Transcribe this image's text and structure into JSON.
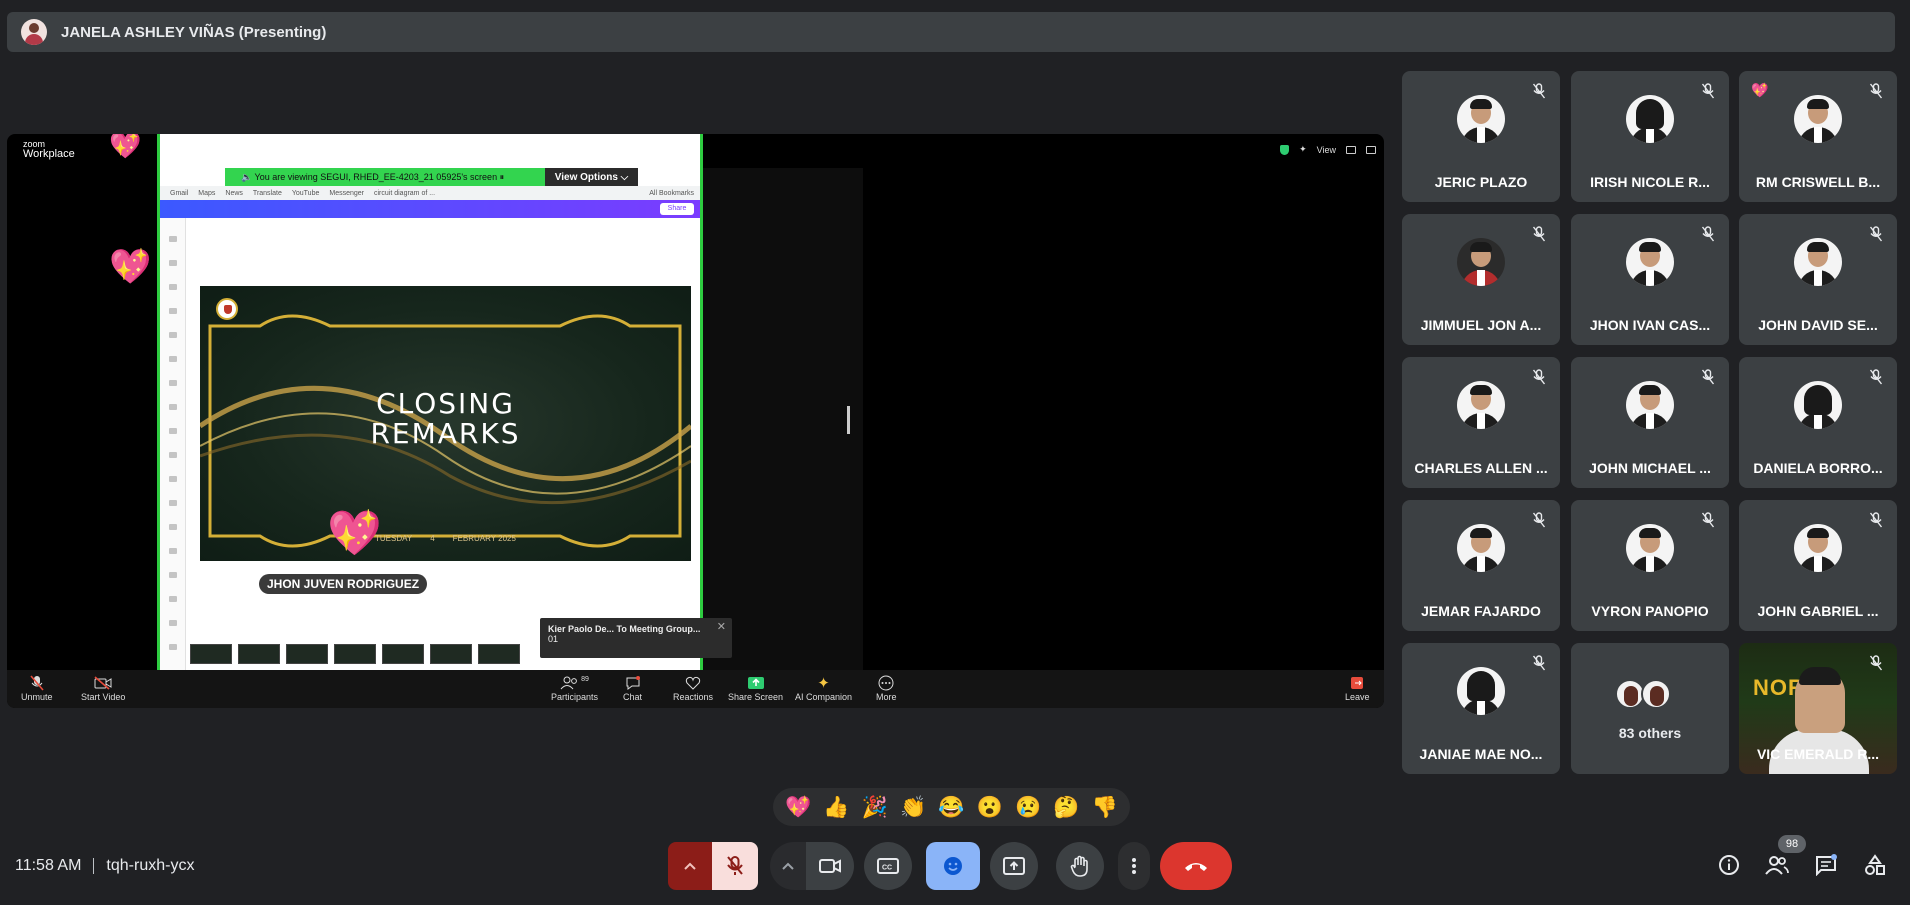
{
  "presenter": {
    "name": "JANELA ASHLEY VIÑAS (Presenting)"
  },
  "shared_screen": {
    "app_name_line1": "zoom",
    "app_name_line2": "Workplace",
    "view_label": "View",
    "banner_text": "🔈 You are viewing  SEGUI, RHED_EE-4203_21 05925's screen  ⏸",
    "view_options_label": "View Options ⌵",
    "browser_bookmarks": [
      "Gmail",
      "Maps",
      "News",
      "Translate",
      "YouTube",
      "Messenger",
      "circuit diagram of ...",
      "All Bookmarks"
    ],
    "share_label": "Share",
    "slide": {
      "title_line1": "CLOSING",
      "title_line2": "REMARKS",
      "date_day": "TUESDAY",
      "date_num": "4",
      "date_month": "FEBRUARY 2025"
    },
    "speaker_label": "JHON JUVEN RODRIGUEZ",
    "chat_toast": {
      "line1": "Kier Paolo De... To Meeting Group...",
      "line2": "01",
      "close": "✕"
    },
    "toolbar": {
      "unmute": "Unmute",
      "start_video": "Start Video",
      "participants": "Participants",
      "participants_count": "89",
      "chat": "Chat",
      "reactions": "Reactions",
      "share_screen": "Share Screen",
      "ai_companion": "AI Companion",
      "more": "More",
      "leave": "Leave"
    }
  },
  "participants": [
    {
      "name": "JERIC PLAZO"
    },
    {
      "name": "IRISH NICOLE R..."
    },
    {
      "name": "RM CRISWELL B..."
    },
    {
      "name": "JIMMUEL JON A..."
    },
    {
      "name": "JHON IVAN CAS..."
    },
    {
      "name": "JOHN DAVID SE..."
    },
    {
      "name": "CHARLES ALLEN ..."
    },
    {
      "name": "JOHN MICHAEL ..."
    },
    {
      "name": "DANIELA BORRO..."
    },
    {
      "name": "JEMAR FAJARDO"
    },
    {
      "name": "VYRON PANOPIO"
    },
    {
      "name": "JOHN GABRIEL ..."
    },
    {
      "name": "JANIAE MAE NO..."
    },
    {
      "name": "83 others"
    },
    {
      "name": "VIC EMERALD R...",
      "video_wordart": "NORAS"
    }
  ],
  "reactions": [
    "💖",
    "👍",
    "🎉",
    "👏",
    "😂",
    "😮",
    "😢",
    "🤔",
    "👎"
  ],
  "meeting": {
    "time": "11:58 AM",
    "code": "tqh-ruxh-ycx"
  },
  "people_count": "98",
  "colors": {
    "background": "#202124",
    "tile": "#3c4043",
    "accent_blue": "#8ab4f8",
    "leave_red": "#ea4335",
    "mic_off_red": "#8c1d18"
  }
}
